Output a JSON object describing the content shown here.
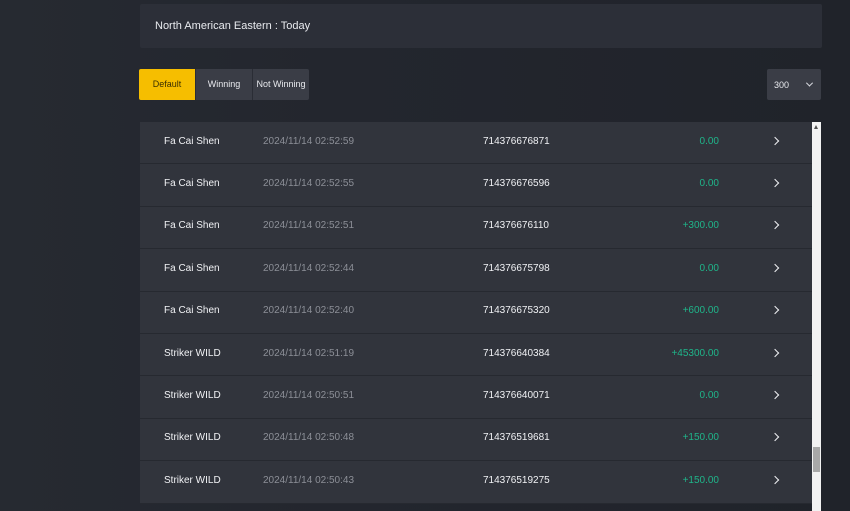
{
  "header": {
    "title": "North American Eastern : Today"
  },
  "filters": [
    {
      "label": "Default",
      "active": true
    },
    {
      "label": "Winning",
      "active": false
    },
    {
      "label": "Not Winning",
      "active": false
    }
  ],
  "page_size": {
    "value": "300"
  },
  "rows": [
    {
      "name": "Fa Cai Shen",
      "time": "2024/11/14 02:52:59",
      "id": "714376676871",
      "amount": "0.00"
    },
    {
      "name": "Fa Cai Shen",
      "time": "2024/11/14 02:52:55",
      "id": "714376676596",
      "amount": "0.00"
    },
    {
      "name": "Fa Cai Shen",
      "time": "2024/11/14 02:52:51",
      "id": "714376676110",
      "amount": "+300.00"
    },
    {
      "name": "Fa Cai Shen",
      "time": "2024/11/14 02:52:44",
      "id": "714376675798",
      "amount": "0.00"
    },
    {
      "name": "Fa Cai Shen",
      "time": "2024/11/14 02:52:40",
      "id": "714376675320",
      "amount": "+600.00"
    },
    {
      "name": "Striker WILD",
      "time": "2024/11/14 02:51:19",
      "id": "714376640384",
      "amount": "+45300.00"
    },
    {
      "name": "Striker WILD",
      "time": "2024/11/14 02:50:51",
      "id": "714376640071",
      "amount": "0.00"
    },
    {
      "name": "Striker WILD",
      "time": "2024/11/14 02:50:48",
      "id": "714376519681",
      "amount": "+150.00"
    },
    {
      "name": "Striker WILD",
      "time": "2024/11/14 02:50:43",
      "id": "714376519275",
      "amount": "+150.00"
    }
  ],
  "colors": {
    "accent": "#f6be00",
    "amount": "#1fb58a",
    "background": "#22252d",
    "row": "#31343c"
  },
  "icons": {
    "row_arrow": "chevron-right-icon",
    "dropdown": "chevron-down-icon"
  }
}
